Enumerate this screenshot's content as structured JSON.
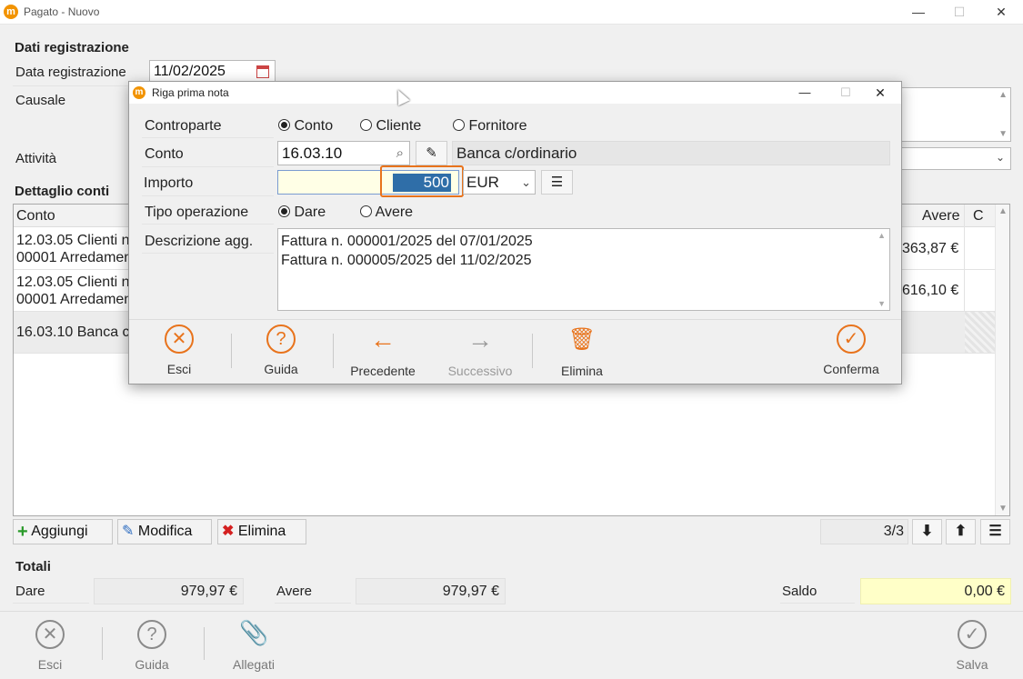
{
  "window": {
    "title": "Pagato - Nuovo",
    "app_icon": "m",
    "min": "—",
    "max": "☐",
    "close": "✕"
  },
  "registration": {
    "section_title": "Dati registrazione",
    "date_label": "Data registrazione",
    "date_value": "11/02/2025",
    "reason_label": "Causale",
    "activity_label": "Attività"
  },
  "details": {
    "section_title": "Dettaglio conti",
    "columns": {
      "account": "Conto",
      "credit": "Avere",
      "c": "C"
    },
    "rows": [
      {
        "line1": "12.03.05 Clienti n",
        "line2": "00001 Arredamen",
        "credit": "363,87 €"
      },
      {
        "line1": "12.03.05 Clienti n",
        "line2": "00001 Arredamen",
        "credit": "616,10 €"
      },
      {
        "line1": "16.03.10 Banca c",
        "line2": "",
        "credit": ""
      }
    ],
    "buttons": {
      "add": "Aggiungi",
      "edit": "Modifica",
      "delete": "Elimina"
    },
    "position": "3/3",
    "nav": {
      "down": "⬇",
      "up": "⬆",
      "menu": "☰"
    }
  },
  "totals": {
    "section_title": "Totali",
    "debit_label": "Dare",
    "debit_value": "979,97 €",
    "credit_label": "Avere",
    "credit_value": "979,97 €",
    "balance_label": "Saldo",
    "balance_value": "0,00 €"
  },
  "toolbar": {
    "exit": "Esci",
    "help": "Guida",
    "attachments": "Allegati",
    "save": "Salva"
  },
  "dialog": {
    "title": "Riga prima nota",
    "counterpart_label": "Controparte",
    "counterpart_options": [
      "Conto",
      "Cliente",
      "Fornitore"
    ],
    "counterpart_selected": "Conto",
    "account_label": "Conto",
    "account_code": "16.03.10",
    "account_name": "Banca c/ordinario",
    "amount_label": "Importo",
    "amount_value": "500",
    "currency": "EUR",
    "operation_label": "Tipo operazione",
    "operation_options": [
      "Dare",
      "Avere"
    ],
    "operation_selected": "Dare",
    "description_label": "Descrizione agg.",
    "description_lines": [
      "Fattura n. 000001/2025 del 07/01/2025",
      "Fattura n. 000005/2025 del 11/02/2025"
    ],
    "buttons": {
      "exit": "Esci",
      "help": "Guida",
      "previous": "Precedente",
      "next": "Successivo",
      "delete": "Elimina",
      "confirm": "Conferma"
    }
  },
  "colors": {
    "accent": "#e8731c",
    "selection": "#2f6ea8",
    "balance_bg": "#ffffc8",
    "amount_bg": "#ffffe6"
  }
}
